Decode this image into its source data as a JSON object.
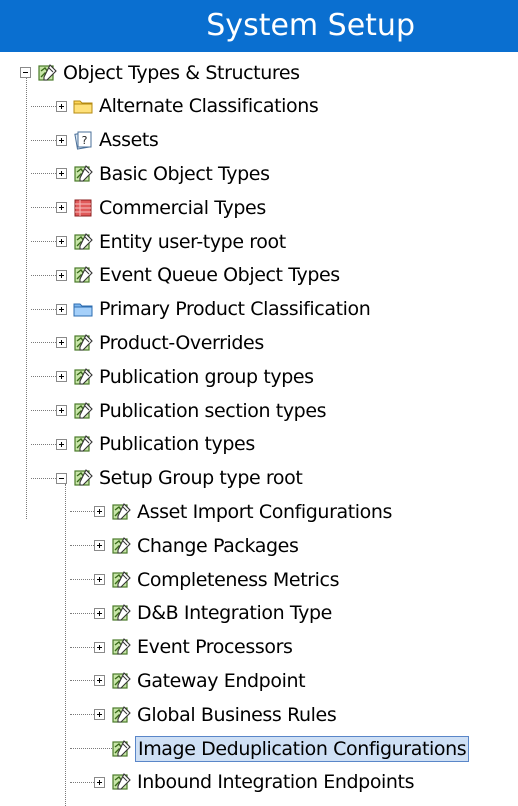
{
  "header": {
    "title": "System Setup",
    "color": "#0a6fd0"
  },
  "tree": {
    "root": {
      "label": "Object Types & Structures",
      "icon": "object-type-icon",
      "expanded": true
    },
    "level1": [
      {
        "label": "Alternate Classifications",
        "icon": "folder-yellow-icon",
        "expanded": false
      },
      {
        "label": "Assets",
        "icon": "asset-unknown-icon",
        "expanded": false
      },
      {
        "label": "Basic Object Types",
        "icon": "object-type-icon",
        "expanded": false
      },
      {
        "label": "Commercial Types",
        "icon": "red-table-icon",
        "expanded": false
      },
      {
        "label": "Entity user-type root",
        "icon": "object-type-icon",
        "expanded": false
      },
      {
        "label": "Event Queue Object Types",
        "icon": "object-type-icon",
        "expanded": false
      },
      {
        "label": "Primary Product Classification",
        "icon": "folder-blue-icon",
        "expanded": false
      },
      {
        "label": "Product-Overrides",
        "icon": "object-type-icon",
        "expanded": false
      },
      {
        "label": "Publication group types",
        "icon": "object-type-icon",
        "expanded": false
      },
      {
        "label": "Publication section types",
        "icon": "object-type-icon",
        "expanded": false
      },
      {
        "label": "Publication types",
        "icon": "object-type-icon",
        "expanded": false
      },
      {
        "label": "Setup Group type root",
        "icon": "object-type-icon",
        "expanded": true
      }
    ],
    "level2": [
      {
        "label": "Asset Import Configurations",
        "icon": "object-type-icon",
        "expandable": true
      },
      {
        "label": "Change Packages",
        "icon": "object-type-icon",
        "expandable": true
      },
      {
        "label": "Completeness Metrics",
        "icon": "object-type-icon",
        "expandable": true
      },
      {
        "label": "D&B Integration Type",
        "icon": "object-type-icon",
        "expandable": true
      },
      {
        "label": "Event Processors",
        "icon": "object-type-icon",
        "expandable": true
      },
      {
        "label": "Gateway Endpoint",
        "icon": "object-type-icon",
        "expandable": true
      },
      {
        "label": "Global Business Rules",
        "icon": "object-type-icon",
        "expandable": true
      },
      {
        "label": "Image Deduplication Configurations",
        "icon": "object-type-icon",
        "expandable": false,
        "selected": true
      },
      {
        "label": "Inbound Integration Endpoints",
        "icon": "object-type-icon",
        "expandable": true
      }
    ]
  }
}
